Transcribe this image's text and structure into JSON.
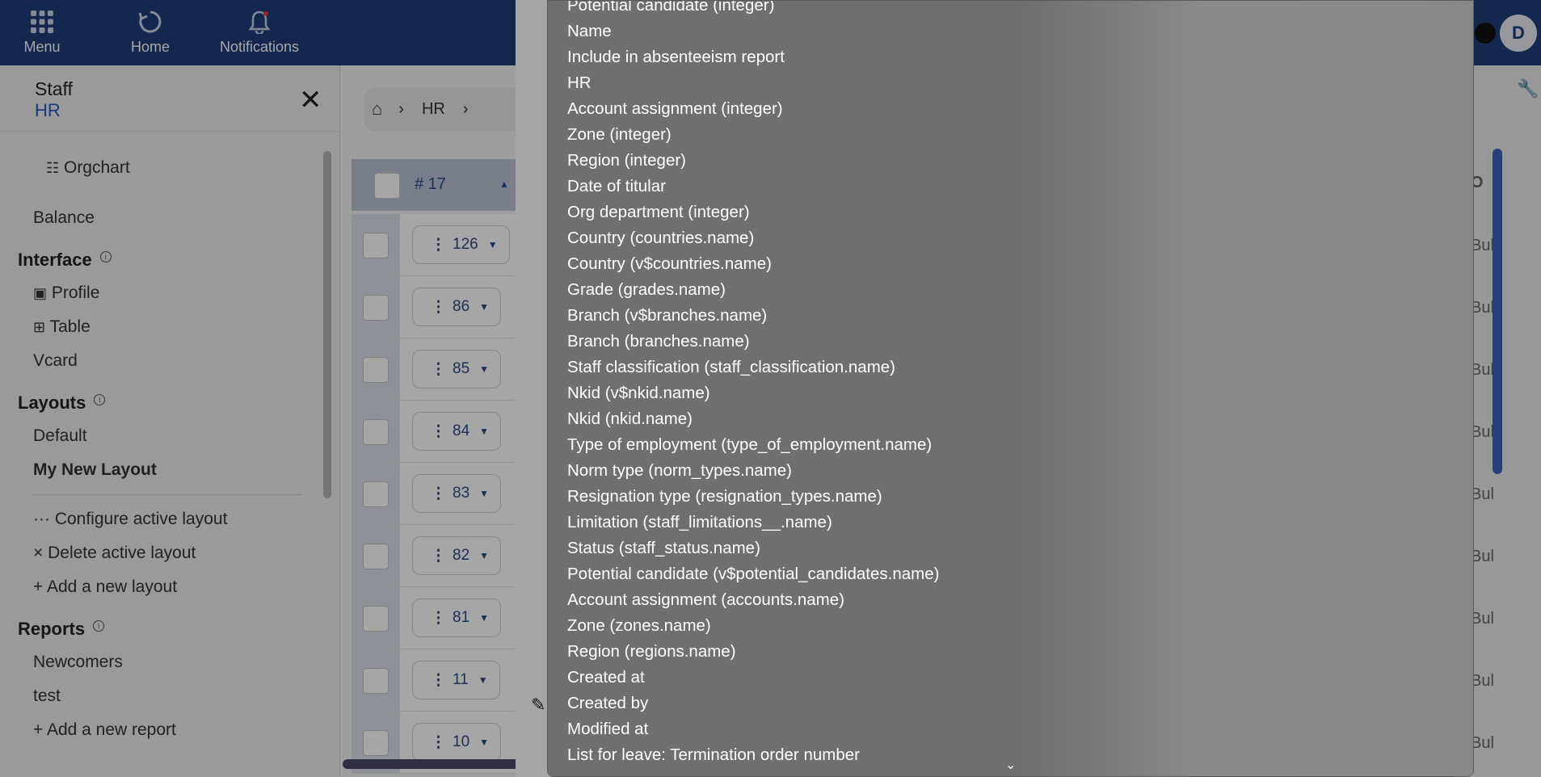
{
  "topbar": {
    "nav": [
      {
        "label": "Menu",
        "icon": "grid-icon"
      },
      {
        "label": "Home",
        "icon": "home-refresh-icon"
      },
      {
        "label": "Notifications",
        "icon": "bell-icon"
      }
    ],
    "avatar_letter": "D",
    "color": "#1f3d7a"
  },
  "sidebar": {
    "title": "Staff",
    "subtitle": "HR",
    "close": "✕",
    "orgchart": "Orgchart",
    "balance": "Balance",
    "interface_heading": "Interface",
    "interface_items": [
      "Profile",
      "Table",
      "Vcard"
    ],
    "layouts_heading": "Layouts",
    "layout_items": [
      "Default",
      "My New Layout"
    ],
    "layout_actions": [
      "··· Configure active layout",
      "× Delete active layout",
      "+ Add a new layout"
    ],
    "reports_heading": "Reports",
    "report_items": [
      "Newcomers",
      "test",
      "+ Add a new report"
    ]
  },
  "breadcrumb": {
    "section": "HR"
  },
  "grid": {
    "header_count": "# 17",
    "rows": [
      "126",
      "86",
      "85",
      "84",
      "83",
      "82",
      "81",
      "11",
      "10"
    ],
    "right_header": "O",
    "right_cell": "Bul"
  },
  "dropdown": {
    "options": [
      "Potential candidate (integer)",
      "Name",
      "Include in absenteeism report",
      "HR",
      "Account assignment (integer)",
      "Zone (integer)",
      "Region (integer)",
      "Date of titular",
      "Org department (integer)",
      "Country (countries.name)",
      "Country (v$countries.name)",
      "Grade (grades.name)",
      "Branch (v$branches.name)",
      "Branch (branches.name)",
      "Staff classification (staff_classification.name)",
      "Nkid (v$nkid.name)",
      "Nkid (nkid.name)",
      "Type of employment (type_of_employment.name)",
      "Norm type (norm_types.name)",
      "Resignation type (resignation_types.name)",
      "Limitation (staff_limitations__.name)",
      "Status (staff_status.name)",
      "Potential candidate (v$potential_candidates.name)",
      "Account assignment (accounts.name)",
      "Zone (zones.name)",
      "Region (regions.name)",
      "Created at",
      "Created by",
      "Modified at",
      "List for leave: Termination order number"
    ]
  }
}
